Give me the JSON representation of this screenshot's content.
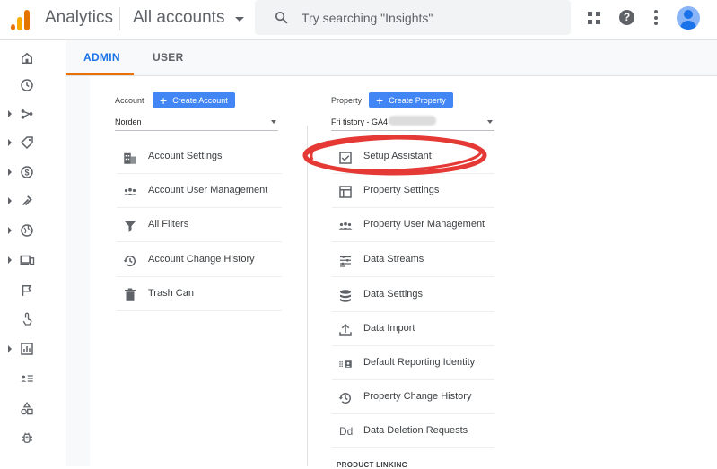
{
  "app": {
    "title": "Analytics",
    "account_switcher": "All accounts"
  },
  "search": {
    "placeholder": "Try searching \"Insights\""
  },
  "tabs": [
    {
      "label": "ADMIN",
      "active": true
    },
    {
      "label": "USER",
      "active": false
    }
  ],
  "account": {
    "header_label": "Account",
    "create_button": "Create Account",
    "selected": "Norden",
    "items": [
      {
        "label": "Account Settings",
        "icon": "building-icon"
      },
      {
        "label": "Account User Management",
        "icon": "people-icon"
      },
      {
        "label": "All Filters",
        "icon": "filter-icon"
      },
      {
        "label": "Account Change History",
        "icon": "history-icon"
      },
      {
        "label": "Trash Can",
        "icon": "trash-icon"
      }
    ]
  },
  "property": {
    "header_label": "Property",
    "create_button": "Create Property",
    "selected": "Fri tistory - GA4",
    "items": [
      {
        "label": "Setup Assistant",
        "icon": "checkbox-icon",
        "highlighted": true
      },
      {
        "label": "Property Settings",
        "icon": "layout-icon"
      },
      {
        "label": "Property User Management",
        "icon": "people-icon"
      },
      {
        "label": "Data Streams",
        "icon": "streams-icon"
      },
      {
        "label": "Data Settings",
        "icon": "database-icon"
      },
      {
        "label": "Data Import",
        "icon": "upload-icon"
      },
      {
        "label": "Default Reporting Identity",
        "icon": "identity-icon"
      },
      {
        "label": "Property Change History",
        "icon": "history-icon"
      },
      {
        "label": "Data Deletion Requests",
        "icon": "dd-icon"
      }
    ],
    "section_label": "PRODUCT LINKING"
  },
  "colors": {
    "accent": "#1a73e8",
    "button": "#4285f4",
    "tab_underline": "#e8710a",
    "annotation": "#e53935"
  }
}
